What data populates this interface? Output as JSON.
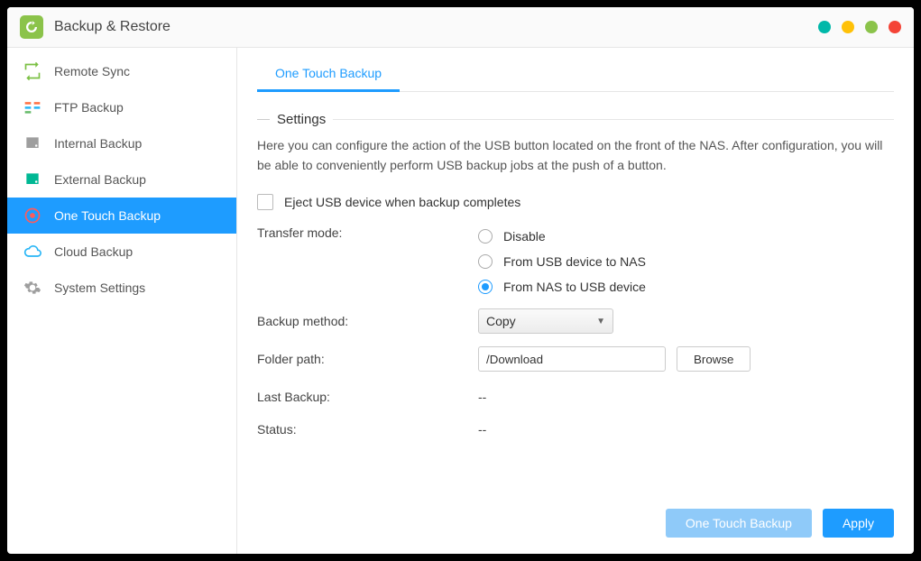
{
  "titlebar": {
    "title": "Backup & Restore"
  },
  "sidebar": {
    "items": [
      {
        "label": "Remote Sync"
      },
      {
        "label": "FTP Backup"
      },
      {
        "label": "Internal Backup"
      },
      {
        "label": "External Backup"
      },
      {
        "label": "One Touch Backup"
      },
      {
        "label": "Cloud Backup"
      },
      {
        "label": "System Settings"
      }
    ]
  },
  "main": {
    "tab": {
      "label": "One Touch Backup"
    },
    "group_heading": "Settings",
    "description": "Here you can configure the action of the USB button located on the front of the NAS. After configuration, you will be able to conveniently perform USB backup jobs at the push of a button.",
    "eject_label": "Eject USB device when backup completes",
    "transfer_mode_label": "Transfer mode:",
    "transfer_options": {
      "disable": "Disable",
      "usb_to_nas": "From USB device to NAS",
      "nas_to_usb": "From NAS to USB device"
    },
    "backup_method_label": "Backup method:",
    "backup_method_value": "Copy",
    "folder_path_label": "Folder path:",
    "folder_path_value": "/Download",
    "browse_label": "Browse",
    "last_backup_label": "Last Backup:",
    "last_backup_value": "--",
    "status_label": "Status:",
    "status_value": "--"
  },
  "footer": {
    "one_touch_label": "One Touch Backup",
    "apply_label": "Apply"
  }
}
